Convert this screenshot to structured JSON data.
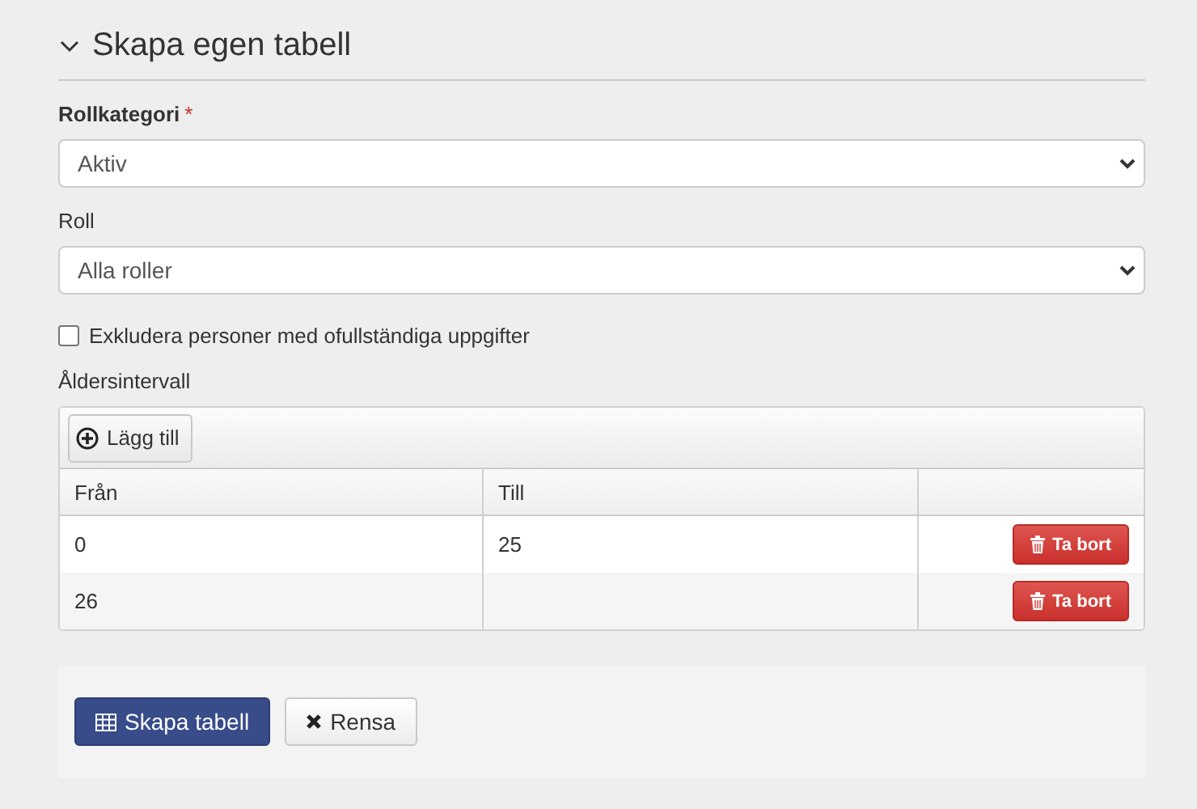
{
  "section": {
    "title": "Skapa egen tabell",
    "expanded": true
  },
  "fields": [
    {
      "label": "Rollkategori",
      "required_mark": "*",
      "value": "Aktiv"
    },
    {
      "label": "Roll",
      "value": "Alla roller"
    }
  ],
  "exclude": {
    "label": "Exkludera personer med ofullständiga uppgifter",
    "checked": false
  },
  "age_intervals": {
    "label": "Åldersintervall",
    "add_button": "Lägg till",
    "columns": [
      "Från",
      "Till"
    ],
    "rows": [
      {
        "from": "0",
        "to": "25",
        "remove": "Ta bort"
      },
      {
        "from": "26",
        "remove": "Ta bort"
      }
    ]
  },
  "buttons": [
    {
      "kind": "primary",
      "label": "Skapa tabell"
    },
    {
      "kind": "default",
      "label": "Rensa"
    }
  ]
}
